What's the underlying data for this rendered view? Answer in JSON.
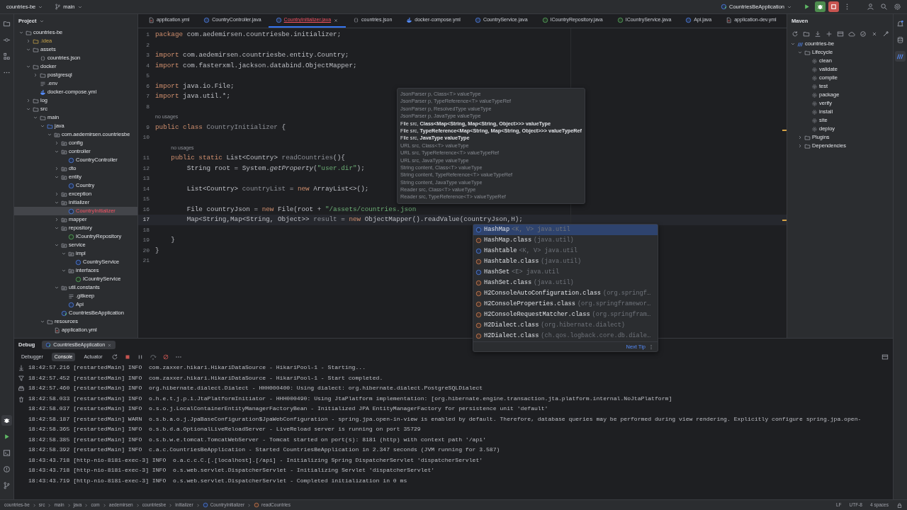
{
  "top_bar": {
    "project": "countries-be",
    "branch": "main",
    "run_config": "CountriesBeApplication"
  },
  "project_panel": {
    "title": "Project",
    "tree": [
      {
        "label": "countries-be",
        "kind": "folder",
        "expanded": true,
        "selected": false,
        "error": false,
        "children": [
          {
            "label": ".idea",
            "kind": "excluded",
            "expanded": false,
            "selected": false,
            "error": false
          },
          {
            "label": "assets",
            "kind": "folder",
            "expanded": true,
            "selected": false,
            "error": false,
            "children": [
              {
                "label": "countries.json",
                "kind": "json",
                "selected": false,
                "error": false
              }
            ]
          },
          {
            "label": "docker",
            "kind": "folder",
            "expanded": true,
            "selected": false,
            "error": false,
            "children": [
              {
                "label": "postgresql",
                "kind": "folder",
                "expanded": false,
                "selected": false,
                "error": false
              },
              {
                "label": ".env",
                "kind": "text",
                "selected": false,
                "error": false
              },
              {
                "label": "docker-compose.yml",
                "kind": "docker",
                "selected": false,
                "error": false
              }
            ]
          },
          {
            "label": "log",
            "kind": "folder",
            "expanded": false,
            "selected": false,
            "error": false
          },
          {
            "label": "src",
            "kind": "folder",
            "expanded": true,
            "selected": false,
            "error": false,
            "children": [
              {
                "label": "main",
                "kind": "folder",
                "expanded": true,
                "selected": false,
                "error": false,
                "children": [
                  {
                    "label": "java",
                    "kind": "source",
                    "expanded": true,
                    "selected": false,
                    "error": false,
                    "children": [
                      {
                        "label": "com.aedemirsen.countriesbe",
                        "kind": "package",
                        "expanded": true,
                        "selected": false,
                        "error": false,
                        "children": [
                          {
                            "label": "config",
                            "kind": "package",
                            "expanded": false,
                            "selected": false,
                            "error": false
                          },
                          {
                            "label": "controller",
                            "kind": "package",
                            "expanded": true,
                            "selected": false,
                            "error": false,
                            "children": [
                              {
                                "label": "CountryController",
                                "kind": "class",
                                "selected": false,
                                "error": false
                              }
                            ]
                          },
                          {
                            "label": "dto",
                            "kind": "package",
                            "expanded": false,
                            "selected": false,
                            "error": false
                          },
                          {
                            "label": "entity",
                            "kind": "package",
                            "expanded": true,
                            "selected": false,
                            "error": false,
                            "children": [
                              {
                                "label": "Country",
                                "kind": "class",
                                "selected": false,
                                "error": false
                              }
                            ]
                          },
                          {
                            "label": "exception",
                            "kind": "package",
                            "expanded": false,
                            "selected": false,
                            "error": false
                          },
                          {
                            "label": "initializer",
                            "kind": "package",
                            "expanded": true,
                            "selected": false,
                            "error": false,
                            "children": [
                              {
                                "label": "CountryInitializer",
                                "kind": "class",
                                "selected": true,
                                "error": true
                              }
                            ]
                          },
                          {
                            "label": "mapper",
                            "kind": "package",
                            "expanded": false,
                            "selected": false,
                            "error": false
                          },
                          {
                            "label": "repository",
                            "kind": "package",
                            "expanded": true,
                            "selected": false,
                            "error": false,
                            "children": [
                              {
                                "label": "ICountryRepository",
                                "kind": "interface",
                                "selected": false,
                                "error": false
                              }
                            ]
                          },
                          {
                            "label": "service",
                            "kind": "package",
                            "expanded": true,
                            "selected": false,
                            "error": false,
                            "children": [
                              {
                                "label": "impl",
                                "kind": "package",
                                "expanded": true,
                                "selected": false,
                                "error": false,
                                "children": [
                                  {
                                    "label": "CountryService",
                                    "kind": "class",
                                    "selected": false,
                                    "error": false
                                  }
                                ]
                              },
                              {
                                "label": "interfaces",
                                "kind": "package",
                                "expanded": true,
                                "selected": false,
                                "error": false,
                                "children": [
                                  {
                                    "label": "ICountryService",
                                    "kind": "interface",
                                    "selected": false,
                                    "error": false
                                  }
                                ]
                              }
                            ]
                          },
                          {
                            "label": "util.constants",
                            "kind": "package",
                            "expanded": true,
                            "selected": false,
                            "error": false,
                            "children": [
                              {
                                "label": ".gitkeep",
                                "kind": "text",
                                "selected": false,
                                "error": false
                              },
                              {
                                "label": "Api",
                                "kind": "class",
                                "selected": false,
                                "error": false
                              }
                            ]
                          },
                          {
                            "label": "CountriesBeApplication",
                            "kind": "spring",
                            "selected": false,
                            "error": false
                          }
                        ]
                      }
                    ]
                  },
                  {
                    "label": "resources",
                    "kind": "folder",
                    "expanded": true,
                    "selected": false,
                    "error": false,
                    "children": [
                      {
                        "label": "application.yml",
                        "kind": "yaml",
                        "selected": false,
                        "error": false
                      }
                    ]
                  }
                ]
              }
            ]
          }
        ]
      }
    ]
  },
  "editor_tabs": [
    {
      "label": "application.yml",
      "kind": "yaml",
      "selected": false,
      "error": false
    },
    {
      "label": "CountryController.java",
      "kind": "class",
      "selected": false,
      "error": false
    },
    {
      "label": "CountryInitializer.java",
      "kind": "class",
      "selected": true,
      "error": true
    },
    {
      "label": "countries.json",
      "kind": "json",
      "selected": false,
      "error": false
    },
    {
      "label": "docker-compose.yml",
      "kind": "docker",
      "selected": false,
      "error": false
    },
    {
      "label": "CountryService.java",
      "kind": "class",
      "selected": false,
      "error": false
    },
    {
      "label": "ICountryRepository.java",
      "kind": "interface",
      "selected": false,
      "error": false
    },
    {
      "label": "ICountryService.java",
      "kind": "interface",
      "selected": false,
      "error": false
    },
    {
      "label": "Api.java",
      "kind": "class",
      "selected": false,
      "error": false
    },
    {
      "label": "application-dev.yml",
      "kind": "yaml",
      "selected": false,
      "error": false
    }
  ],
  "editor": {
    "lines": [
      {
        "kind": "code",
        "number": "1",
        "current": false,
        "tokens": [
          {
            "kind": "keyword",
            "text": "package"
          },
          {
            "kind": "plain",
            "text": " com.aedemirsen.countriesbe.initializer;"
          }
        ]
      },
      {
        "kind": "code",
        "number": "2",
        "current": false
      },
      {
        "kind": "code",
        "number": "3",
        "current": false,
        "tokens": [
          {
            "kind": "keyword",
            "text": "import"
          },
          {
            "kind": "plain",
            "text": " com.aedemirsen.countriesbe.entity.Country;"
          }
        ]
      },
      {
        "kind": "code",
        "number": "4",
        "current": false,
        "tokens": [
          {
            "kind": "keyword",
            "text": "import"
          },
          {
            "kind": "plain",
            "text": " com.fasterxml.jackson.databind.ObjectMapper;"
          }
        ]
      },
      {
        "kind": "code",
        "number": "5",
        "current": false
      },
      {
        "kind": "code",
        "number": "6",
        "current": false,
        "tokens": [
          {
            "kind": "keyword",
            "text": "import"
          },
          {
            "kind": "plain",
            "text": " java.io.File;"
          }
        ]
      },
      {
        "kind": "code",
        "number": "7",
        "current": false,
        "tokens": [
          {
            "kind": "keyword",
            "text": "import"
          },
          {
            "kind": "plain",
            "text": " java.util.*;"
          }
        ]
      },
      {
        "kind": "code",
        "number": "8",
        "current": false
      },
      {
        "kind": "hint",
        "text": "no usages"
      },
      {
        "kind": "code",
        "number": "9",
        "current": false,
        "tokens": [
          {
            "kind": "keyword",
            "text": "public class "
          },
          {
            "kind": "unused",
            "text": "CountryInitializer"
          },
          {
            "kind": "plain",
            "text": " {"
          }
        ]
      },
      {
        "kind": "code",
        "number": "10",
        "current": false
      },
      {
        "kind": "hint",
        "text": "no usages"
      },
      {
        "kind": "code",
        "number": "11",
        "current": false,
        "tokens": [
          {
            "kind": "keyword",
            "text": "    public static "
          },
          {
            "kind": "plain",
            "text": "List<Country> "
          },
          {
            "kind": "unused",
            "text": "readCountries"
          },
          {
            "kind": "plain",
            "text": "(){"
          }
        ]
      },
      {
        "kind": "code",
        "number": "12",
        "current": false,
        "tokens": [
          {
            "kind": "plain",
            "text": "        String root = System."
          },
          {
            "kind": "static",
            "text": "getProperty"
          },
          {
            "kind": "plain",
            "text": "("
          },
          {
            "kind": "string",
            "text": "\"user.dir\""
          },
          {
            "kind": "plain",
            "text": ");"
          }
        ]
      },
      {
        "kind": "code",
        "number": "13",
        "current": false
      },
      {
        "kind": "code",
        "number": "14",
        "current": false,
        "tokens": [
          {
            "kind": "plain",
            "text": "        List<Country> "
          },
          {
            "kind": "unused",
            "text": "countryList"
          },
          {
            "kind": "plain",
            "text": " = "
          },
          {
            "kind": "keyword",
            "text": "new"
          },
          {
            "kind": "plain",
            "text": " ArrayList<>();"
          }
        ]
      },
      {
        "kind": "code",
        "number": "15",
        "current": false
      },
      {
        "kind": "code",
        "number": "16",
        "current": false,
        "tokens": [
          {
            "kind": "plain",
            "text": "        File countryJson = "
          },
          {
            "kind": "keyword",
            "text": "new"
          },
          {
            "kind": "plain",
            "text": " File(root + "
          },
          {
            "kind": "string",
            "text": "\"/assets/countries.json"
          }
        ]
      },
      {
        "kind": "code",
        "number": "17",
        "current": true,
        "tokens": [
          {
            "kind": "plain",
            "text": "        Map<String,Map<String, Object>> "
          },
          {
            "kind": "unused",
            "text": "result"
          },
          {
            "kind": "plain",
            "text": " = "
          },
          {
            "kind": "keyword",
            "text": "new"
          },
          {
            "kind": "plain",
            "text": " ObjectMapper().readValue(countryJson,H);"
          }
        ]
      },
      {
        "kind": "code",
        "number": "18",
        "current": false
      },
      {
        "kind": "code",
        "number": "19",
        "current": false,
        "tokens": [
          {
            "kind": "plain",
            "text": "    }"
          }
        ]
      },
      {
        "kind": "code",
        "number": "20",
        "current": false,
        "tokens": [
          {
            "kind": "plain",
            "text": "}"
          }
        ]
      },
      {
        "kind": "code",
        "number": "21",
        "current": false
      }
    ]
  },
  "parameter_info": [
    {
      "text": "JsonParser p, Class<T> valueType",
      "dim": true
    },
    {
      "text": "JsonParser p, TypeReference<T> valueTypeRef",
      "dim": true
    },
    {
      "text": "JsonParser p, ResolvedType valueType",
      "dim": true
    },
    {
      "text": "JsonParser p, JavaType valueType",
      "dim": true
    },
    {
      "text": "File src, **Class<Map<String, Map<String, Object>>> valueType**",
      "dim": false
    },
    {
      "text": "File src, **TypeReference<Map<String, Map<String, Object>>> valueTypeRef**",
      "dim": false
    },
    {
      "text": "File src, **JavaType valueType**",
      "dim": false
    },
    {
      "text": "URL src, Class<T> valueType",
      "dim": true
    },
    {
      "text": "URL src, TypeReference<T> valueTypeRef",
      "dim": true
    },
    {
      "text": "URL src, JavaType valueType",
      "dim": true
    },
    {
      "text": "String content, Class<T> valueType",
      "dim": true
    },
    {
      "text": "String content, TypeReference<T> valueTypeRef",
      "dim": true
    },
    {
      "text": "String content, JavaType valueType",
      "dim": true
    },
    {
      "text": "Reader src, Class<T> valueType",
      "dim": true
    },
    {
      "text": "Reader src, TypeReference<T> valueTypeRef",
      "dim": true
    }
  ],
  "completion": {
    "items": [
      {
        "name": "HashMap",
        "suffix": "<K, V> java.util",
        "kind": "class",
        "selected": true
      },
      {
        "name": "HashMap.class",
        "suffix": " (java.util)",
        "kind": "literal",
        "selected": false
      },
      {
        "name": "Hashtable",
        "suffix": "<K, V> java.util",
        "kind": "class",
        "selected": false
      },
      {
        "name": "Hashtable.class",
        "suffix": " (java.util)",
        "kind": "literal",
        "selected": false
      },
      {
        "name": "HashSet",
        "suffix": "<E> java.util",
        "kind": "class",
        "selected": false
      },
      {
        "name": "HashSet.class",
        "suffix": " (java.util)",
        "kind": "literal",
        "selected": false
      },
      {
        "name": "H2ConsoleAutoConfiguration.class",
        "suffix": " (org.springf…",
        "kind": "literal",
        "selected": false
      },
      {
        "name": "H2ConsoleProperties.class",
        "suffix": " (org.springframewor…",
        "kind": "literal",
        "selected": false
      },
      {
        "name": "H2ConsoleRequestMatcher.class",
        "suffix": " (org.springfram…",
        "kind": "literal",
        "selected": false
      },
      {
        "name": "H2Dialect.class",
        "suffix": " (org.hibernate.dialect)",
        "kind": "literal",
        "selected": false
      },
      {
        "name": "H2Dialect.class",
        "suffix": " (ch.qos.logback.core.db.diale…",
        "kind": "literal",
        "selected": false
      }
    ],
    "footer_link": "Next Tip"
  },
  "maven_panel": {
    "title": "Maven",
    "tree": [
      {
        "label": "countries-be",
        "kind": "maven",
        "expanded": true,
        "children": [
          {
            "label": "Lifecycle",
            "kind": "folder",
            "expanded": true,
            "children": [
              {
                "label": "clean",
                "kind": "goal"
              },
              {
                "label": "validate",
                "kind": "goal"
              },
              {
                "label": "compile",
                "kind": "goal"
              },
              {
                "label": "test",
                "kind": "goal"
              },
              {
                "label": "package",
                "kind": "goal"
              },
              {
                "label": "verify",
                "kind": "goal"
              },
              {
                "label": "install",
                "kind": "goal"
              },
              {
                "label": "site",
                "kind": "goal"
              },
              {
                "label": "deploy",
                "kind": "goal"
              }
            ]
          },
          {
            "label": "Plugins",
            "kind": "folder",
            "expanded": false
          },
          {
            "label": "Dependencies",
            "kind": "folder",
            "expanded": false
          }
        ]
      }
    ]
  },
  "debug_panel": {
    "title": "Debug",
    "session": "CountriesBeApplication",
    "tabs": [
      {
        "label": "Debugger",
        "selected": false
      },
      {
        "label": "Console",
        "selected": true
      },
      {
        "label": "Actuator",
        "selected": false
      }
    ],
    "console_lines": [
      "18:42:57.216 [restartedMain] INFO  com.zaxxer.hikari.HikariDataSource - HikariPool-1 - Starting...",
      "18:42:57.452 [restartedMain] INFO  com.zaxxer.hikari.HikariDataSource - HikariPool-1 - Start completed.",
      "18:42:57.460 [restartedMain] INFO  org.hibernate.dialect.Dialect - HHH000400: Using dialect: org.hibernate.dialect.PostgreSQLDialect",
      "18:42:58.033 [restartedMain] INFO  o.h.e.t.j.p.i.JtaPlatformInitiator - HHH000490: Using JtaPlatform implementation: [org.hibernate.engine.transaction.jta.platform.internal.NoJtaPlatform]",
      "18:42:58.037 [restartedMain] INFO  o.s.o.j.LocalContainerEntityManagerFactoryBean - Initialized JPA EntityManagerFactory for persistence unit 'default'",
      "18:42:58.187 [restartedMain] WARN  o.s.b.a.o.j.JpaBaseConfiguration$JpaWebConfiguration - spring.jpa.open-in-view is enabled by default. Therefore, database queries may be performed during view rendering. Explicitly configure spring.jpa.open-",
      "18:42:58.365 [restartedMain] INFO  o.s.b.d.a.OptionalLiveReloadServer - LiveReload server is running on port 35729",
      "18:42:58.385 [restartedMain] INFO  o.s.b.w.e.tomcat.TomcatWebServer - Tomcat started on port(s): 8181 (http) with context path '/api'",
      "18:42:58.392 [restartedMain] INFO  c.a.c.CountriesBeApplication - Started CountriesBeApplication in 2.347 seconds (JVM running for 3.587)",
      "18:43:43.718 [http-nio-8181-exec-3] INFO  o.a.c.c.C.[.[localhost].[/api] - Initializing Spring DispatcherServlet 'dispatcherServlet'",
      "18:43:43.718 [http-nio-8181-exec-3] INFO  o.s.web.servlet.DispatcherServlet - Initializing Servlet 'dispatcherServlet'",
      "18:43:43.719 [http-nio-8181-exec-3] INFO  o.s.web.servlet.DispatcherServlet - Completed initialization in 0 ms"
    ]
  },
  "status_bar": {
    "breadcrumbs": [
      "countries-be",
      "src",
      "main",
      "java",
      "com",
      "aedemirsen",
      "countriesbe",
      "initializer",
      "CountryInitializer",
      "readCountries"
    ],
    "right": [
      "LF",
      "UTF-8",
      "4 spaces"
    ]
  }
}
